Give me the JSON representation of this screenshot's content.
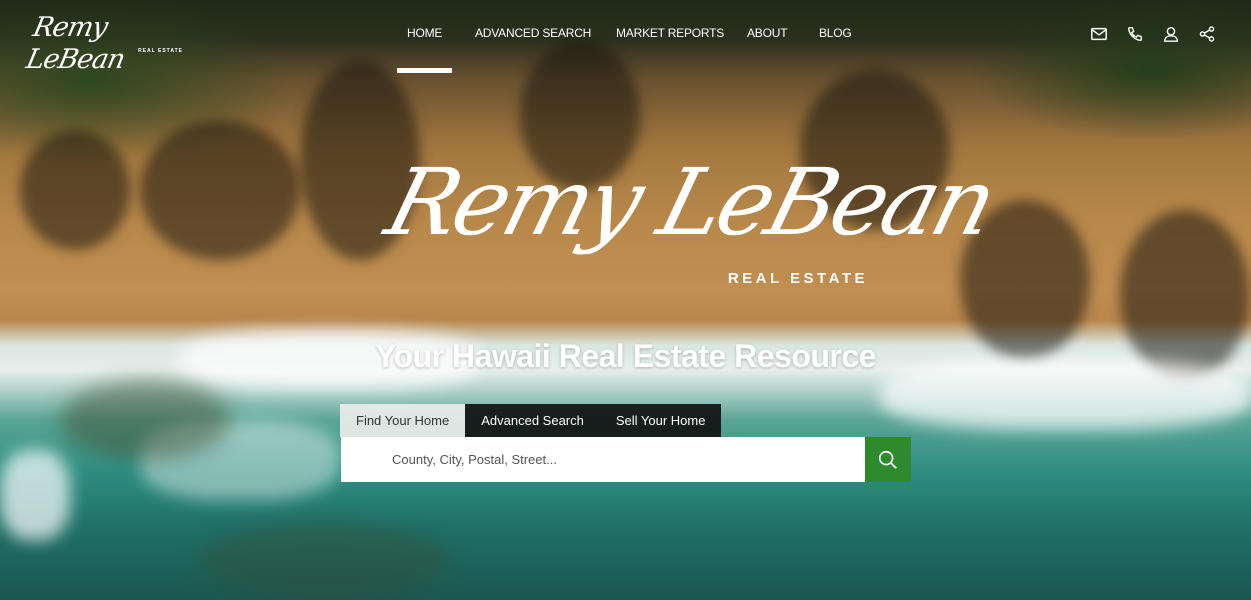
{
  "brand": {
    "name": "Remy LeBean",
    "subtitle": "REAL ESTATE"
  },
  "nav": {
    "items": [
      {
        "label": "HOME",
        "active": true
      },
      {
        "label": "ADVANCED SEARCH"
      },
      {
        "label": "MARKET REPORTS"
      },
      {
        "label": "ABOUT"
      },
      {
        "label": "BLOG"
      }
    ]
  },
  "header_icons": [
    "mail-icon",
    "phone-icon",
    "user-icon",
    "share-icon"
  ],
  "hero": {
    "logo_script": "Remy LeBean",
    "logo_subtitle": "REAL ESTATE",
    "tagline": "Your Hawaii Real Estate Resource"
  },
  "search": {
    "tabs": [
      {
        "label": "Find Your Home",
        "active": true
      },
      {
        "label": "Advanced Search"
      },
      {
        "label": "Sell Your Home"
      }
    ],
    "placeholder": "County, City, Postal, Street...",
    "value": "",
    "button_icon": "search-icon"
  },
  "colors": {
    "accent_green": "#2d8a2d",
    "tab_dark": "#121212",
    "tab_active": "#ebeeec"
  }
}
